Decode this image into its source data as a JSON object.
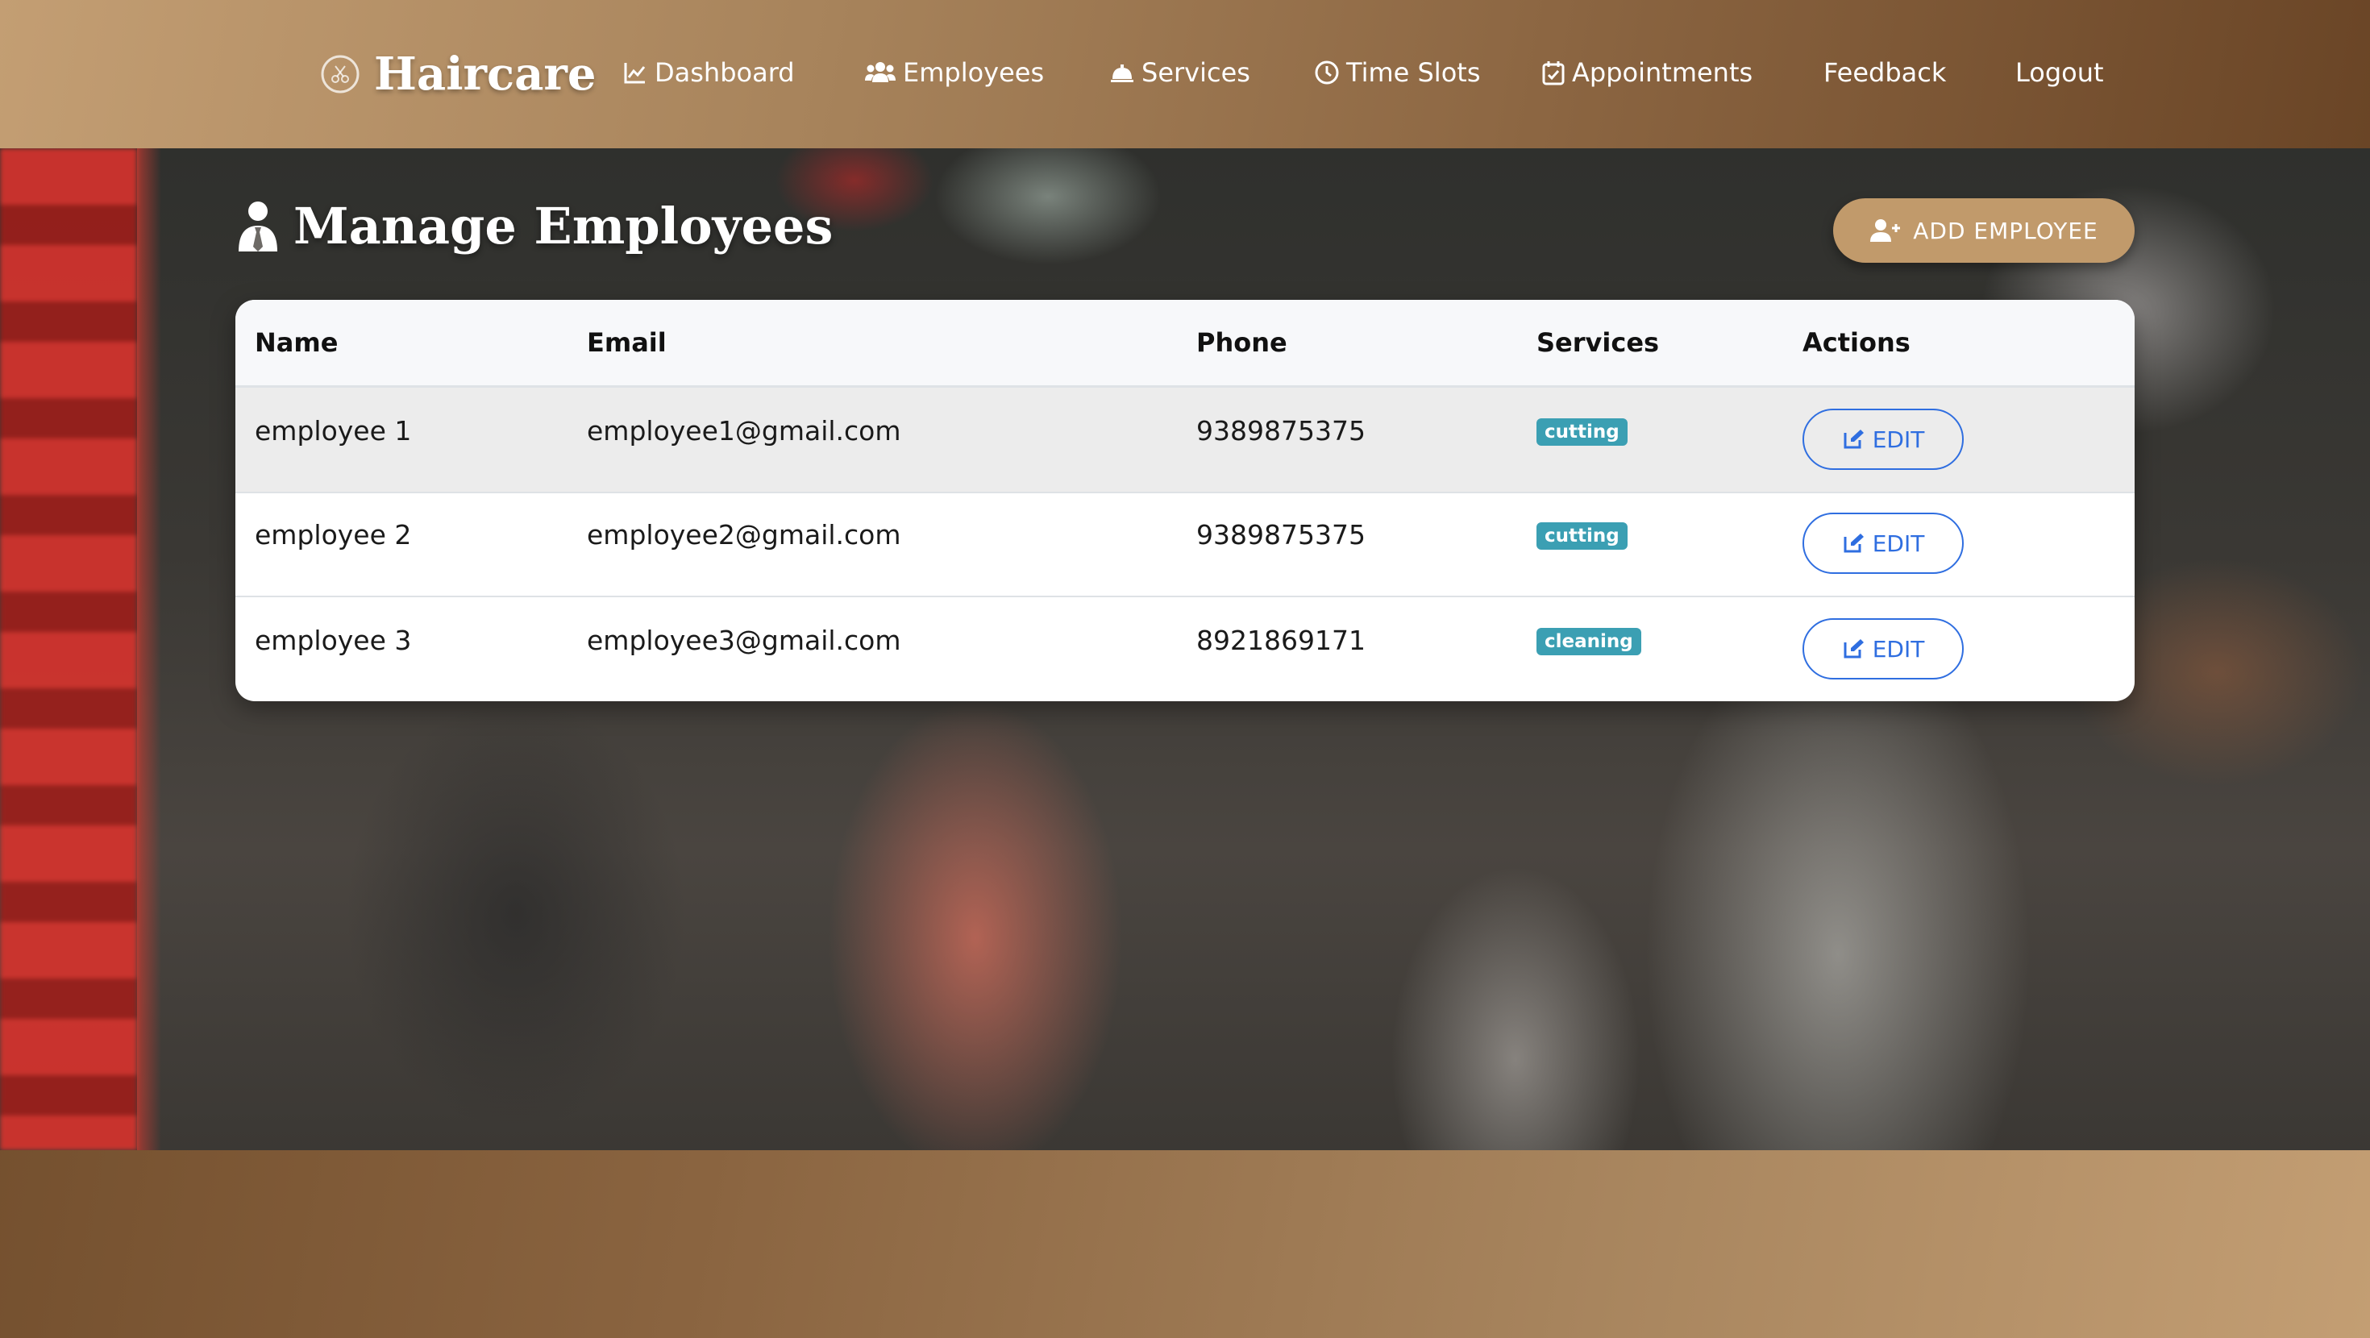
{
  "brand": {
    "name": "Haircare"
  },
  "nav": {
    "items": [
      {
        "label": "Dashboard",
        "icon": "chart-line-icon"
      },
      {
        "label": "Employees",
        "icon": "users-icon"
      },
      {
        "label": "Services",
        "icon": "bell-service-icon"
      },
      {
        "label": "Time Slots",
        "icon": "clock-icon"
      },
      {
        "label": "Appointments",
        "icon": "calendar-check-icon"
      },
      {
        "label": "Feedback",
        "icon": ""
      },
      {
        "label": "Logout",
        "icon": ""
      }
    ]
  },
  "page": {
    "title": "Manage Employees",
    "add_button": "ADD EMPLOYEE"
  },
  "table": {
    "columns": [
      "Name",
      "Email",
      "Phone",
      "Services",
      "Actions"
    ],
    "rows": [
      {
        "name": "employee 1",
        "email": "employee1@gmail.com",
        "phone": "9389875375",
        "service": "cutting",
        "action": "EDIT"
      },
      {
        "name": "employee 2",
        "email": "employee2@gmail.com",
        "phone": "9389875375",
        "service": "cutting",
        "action": "EDIT"
      },
      {
        "name": "employee 3",
        "email": "employee3@gmail.com",
        "phone": "8921869171",
        "service": "cleaning",
        "action": "EDIT"
      }
    ]
  },
  "colors": {
    "accent": "#c19a6b",
    "badge": "#3b9fb3",
    "edit": "#2f6ee0"
  }
}
